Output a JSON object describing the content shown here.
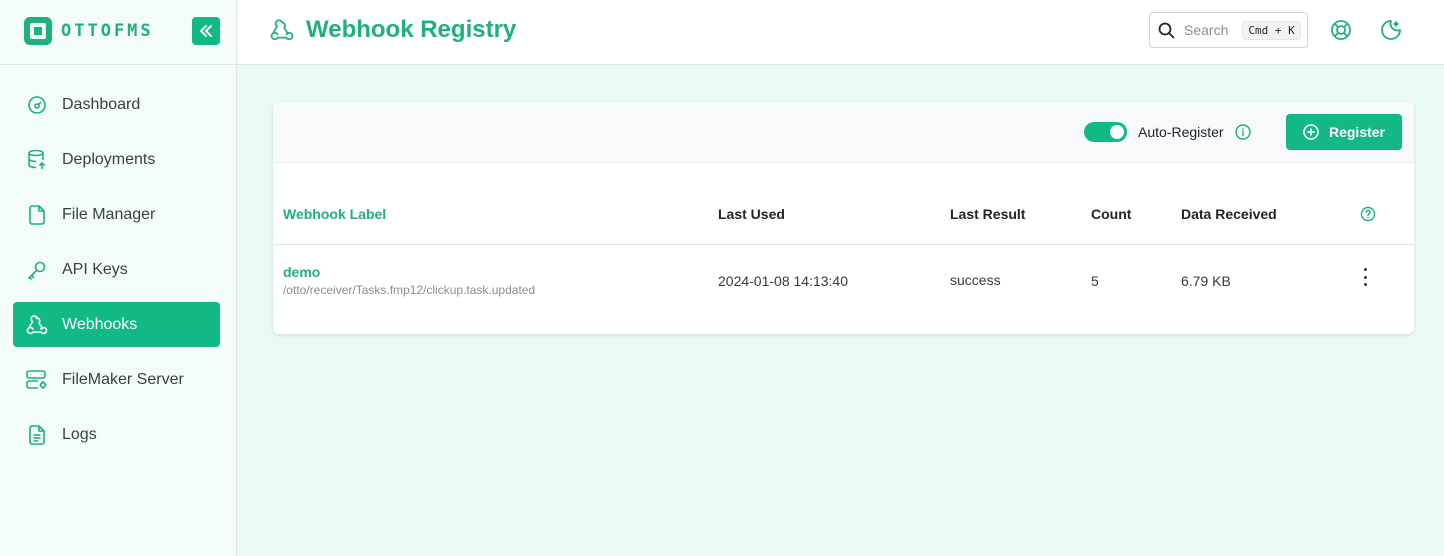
{
  "brand": {
    "name": "OTTOFMS",
    "accent": "#12b886"
  },
  "sidebar": {
    "items": [
      {
        "label": "Dashboard",
        "icon": "dashboard-gauge-icon",
        "active": false
      },
      {
        "label": "Deployments",
        "icon": "database-upload-icon",
        "active": false
      },
      {
        "label": "File Manager",
        "icon": "file-icon",
        "active": false
      },
      {
        "label": "API Keys",
        "icon": "key-icon",
        "active": false
      },
      {
        "label": "Webhooks",
        "icon": "webhook-icon",
        "active": true
      },
      {
        "label": "FileMaker Server",
        "icon": "server-cog-icon",
        "active": false
      },
      {
        "label": "Logs",
        "icon": "file-text-icon",
        "active": false
      }
    ]
  },
  "header": {
    "title": "Webhook Registry",
    "search": {
      "placeholder": "Search",
      "shortcut": "Cmd + K"
    }
  },
  "toolbar": {
    "auto_register_label": "Auto-Register",
    "auto_register_on": true,
    "register_label": "Register"
  },
  "table": {
    "columns": [
      "Webhook Label",
      "Last Used",
      "Last Result",
      "Count",
      "Data Received"
    ],
    "rows": [
      {
        "label": "demo",
        "path": "/otto/receiver/Tasks.fmp12/clickup.task.updated",
        "last_used": "2024-01-08 14:13:40",
        "last_result": "success",
        "count": "5",
        "data_received": "6.79 KB"
      }
    ]
  }
}
